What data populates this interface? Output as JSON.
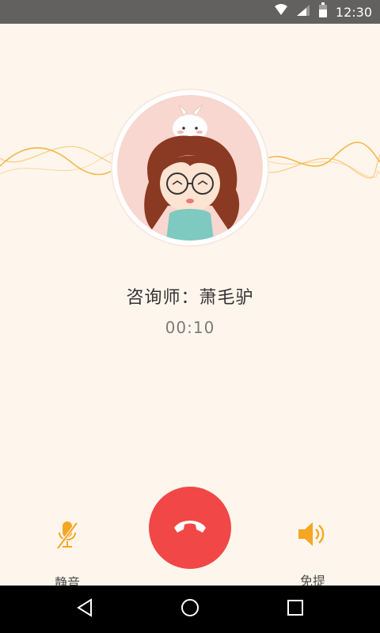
{
  "status_bar": {
    "time": "12:30",
    "icons": [
      "wifi-icon",
      "cellular-signal-icon",
      "battery-icon"
    ],
    "background": "#626160"
  },
  "call": {
    "consultant_name": "咨询师：萧毛驴",
    "duration": "00:10"
  },
  "controls": {
    "mute_label": "静音",
    "speaker_label": "免提",
    "hangup_color": "#f24747",
    "accent_color": "#f5a623"
  },
  "nav": {
    "buttons": [
      "back-icon",
      "home-icon",
      "recent-apps-icon"
    ]
  },
  "theme": {
    "background": "#fef6ec"
  }
}
